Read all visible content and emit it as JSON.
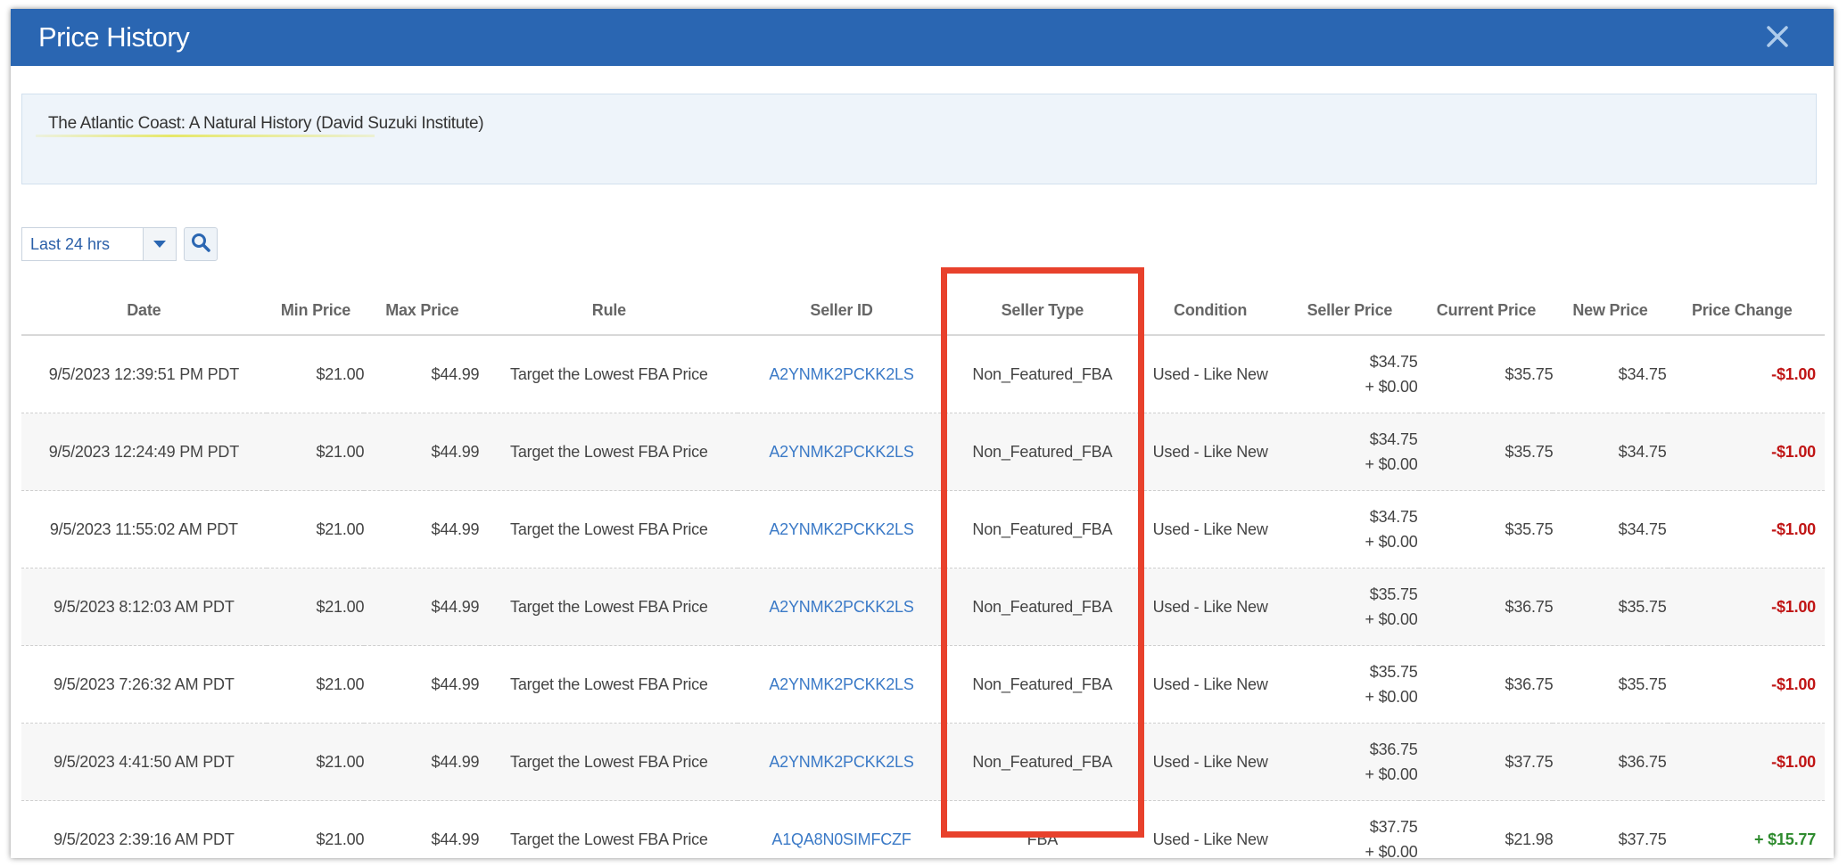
{
  "dialog": {
    "title": "Price History",
    "close_icon": "close-icon"
  },
  "product": {
    "title": "The Atlantic Coast: A Natural History (David Suzuki Institute)"
  },
  "filter": {
    "range_value": "Last 24 hrs",
    "search_icon": "search-icon"
  },
  "columns": [
    "Date",
    "Min Price",
    "Max Price",
    "Rule",
    "Seller ID",
    "Seller Type",
    "Condition",
    "Seller Price",
    "Current Price",
    "New Price",
    "Price Change"
  ],
  "rows": [
    {
      "date": "9/5/2023 12:39:51 PM PDT",
      "min": "$21.00",
      "max": "$44.99",
      "rule": "Target the Lowest FBA Price",
      "seller_id": "A2YNMK2PCKK2LS",
      "seller_type": "Non_Featured_FBA",
      "condition": "Used - Like New",
      "seller_price": "$34.75",
      "shipping": "+ $0.00",
      "current": "$35.75",
      "new": "$34.75",
      "change": "-$1.00"
    },
    {
      "date": "9/5/2023 12:24:49 PM PDT",
      "min": "$21.00",
      "max": "$44.99",
      "rule": "Target the Lowest FBA Price",
      "seller_id": "A2YNMK2PCKK2LS",
      "seller_type": "Non_Featured_FBA",
      "condition": "Used - Like New",
      "seller_price": "$34.75",
      "shipping": "+ $0.00",
      "current": "$35.75",
      "new": "$34.75",
      "change": "-$1.00"
    },
    {
      "date": "9/5/2023 11:55:02 AM PDT",
      "min": "$21.00",
      "max": "$44.99",
      "rule": "Target the Lowest FBA Price",
      "seller_id": "A2YNMK2PCKK2LS",
      "seller_type": "Non_Featured_FBA",
      "condition": "Used - Like New",
      "seller_price": "$34.75",
      "shipping": "+ $0.00",
      "current": "$35.75",
      "new": "$34.75",
      "change": "-$1.00"
    },
    {
      "date": "9/5/2023 8:12:03 AM PDT",
      "min": "$21.00",
      "max": "$44.99",
      "rule": "Target the Lowest FBA Price",
      "seller_id": "A2YNMK2PCKK2LS",
      "seller_type": "Non_Featured_FBA",
      "condition": "Used - Like New",
      "seller_price": "$35.75",
      "shipping": "+ $0.00",
      "current": "$36.75",
      "new": "$35.75",
      "change": "-$1.00"
    },
    {
      "date": "9/5/2023 7:26:32 AM PDT",
      "min": "$21.00",
      "max": "$44.99",
      "rule": "Target the Lowest FBA Price",
      "seller_id": "A2YNMK2PCKK2LS",
      "seller_type": "Non_Featured_FBA",
      "condition": "Used - Like New",
      "seller_price": "$35.75",
      "shipping": "+ $0.00",
      "current": "$36.75",
      "new": "$35.75",
      "change": "-$1.00"
    },
    {
      "date": "9/5/2023 4:41:50 AM PDT",
      "min": "$21.00",
      "max": "$44.99",
      "rule": "Target the Lowest FBA Price",
      "seller_id": "A2YNMK2PCKK2LS",
      "seller_type": "Non_Featured_FBA",
      "condition": "Used - Like New",
      "seller_price": "$36.75",
      "shipping": "+ $0.00",
      "current": "$37.75",
      "new": "$36.75",
      "change": "-$1.00"
    },
    {
      "date": "9/5/2023 2:39:16 AM PDT",
      "min": "$21.00",
      "max": "$44.99",
      "rule": "Target the Lowest FBA Price",
      "seller_id": "A1QA8N0SIMFCZF",
      "seller_type": "FBA",
      "condition": "Used - Like New",
      "seller_price": "$37.75",
      "shipping": "+ $0.00",
      "current": "$21.98",
      "new": "$37.75",
      "change": "+ $15.77"
    }
  ],
  "colors": {
    "header_blue": "#2a66b2",
    "negative": "#c01515",
    "positive": "#2e8b2e",
    "link": "#3b7ac7",
    "annotation_red": "#e8412c"
  }
}
